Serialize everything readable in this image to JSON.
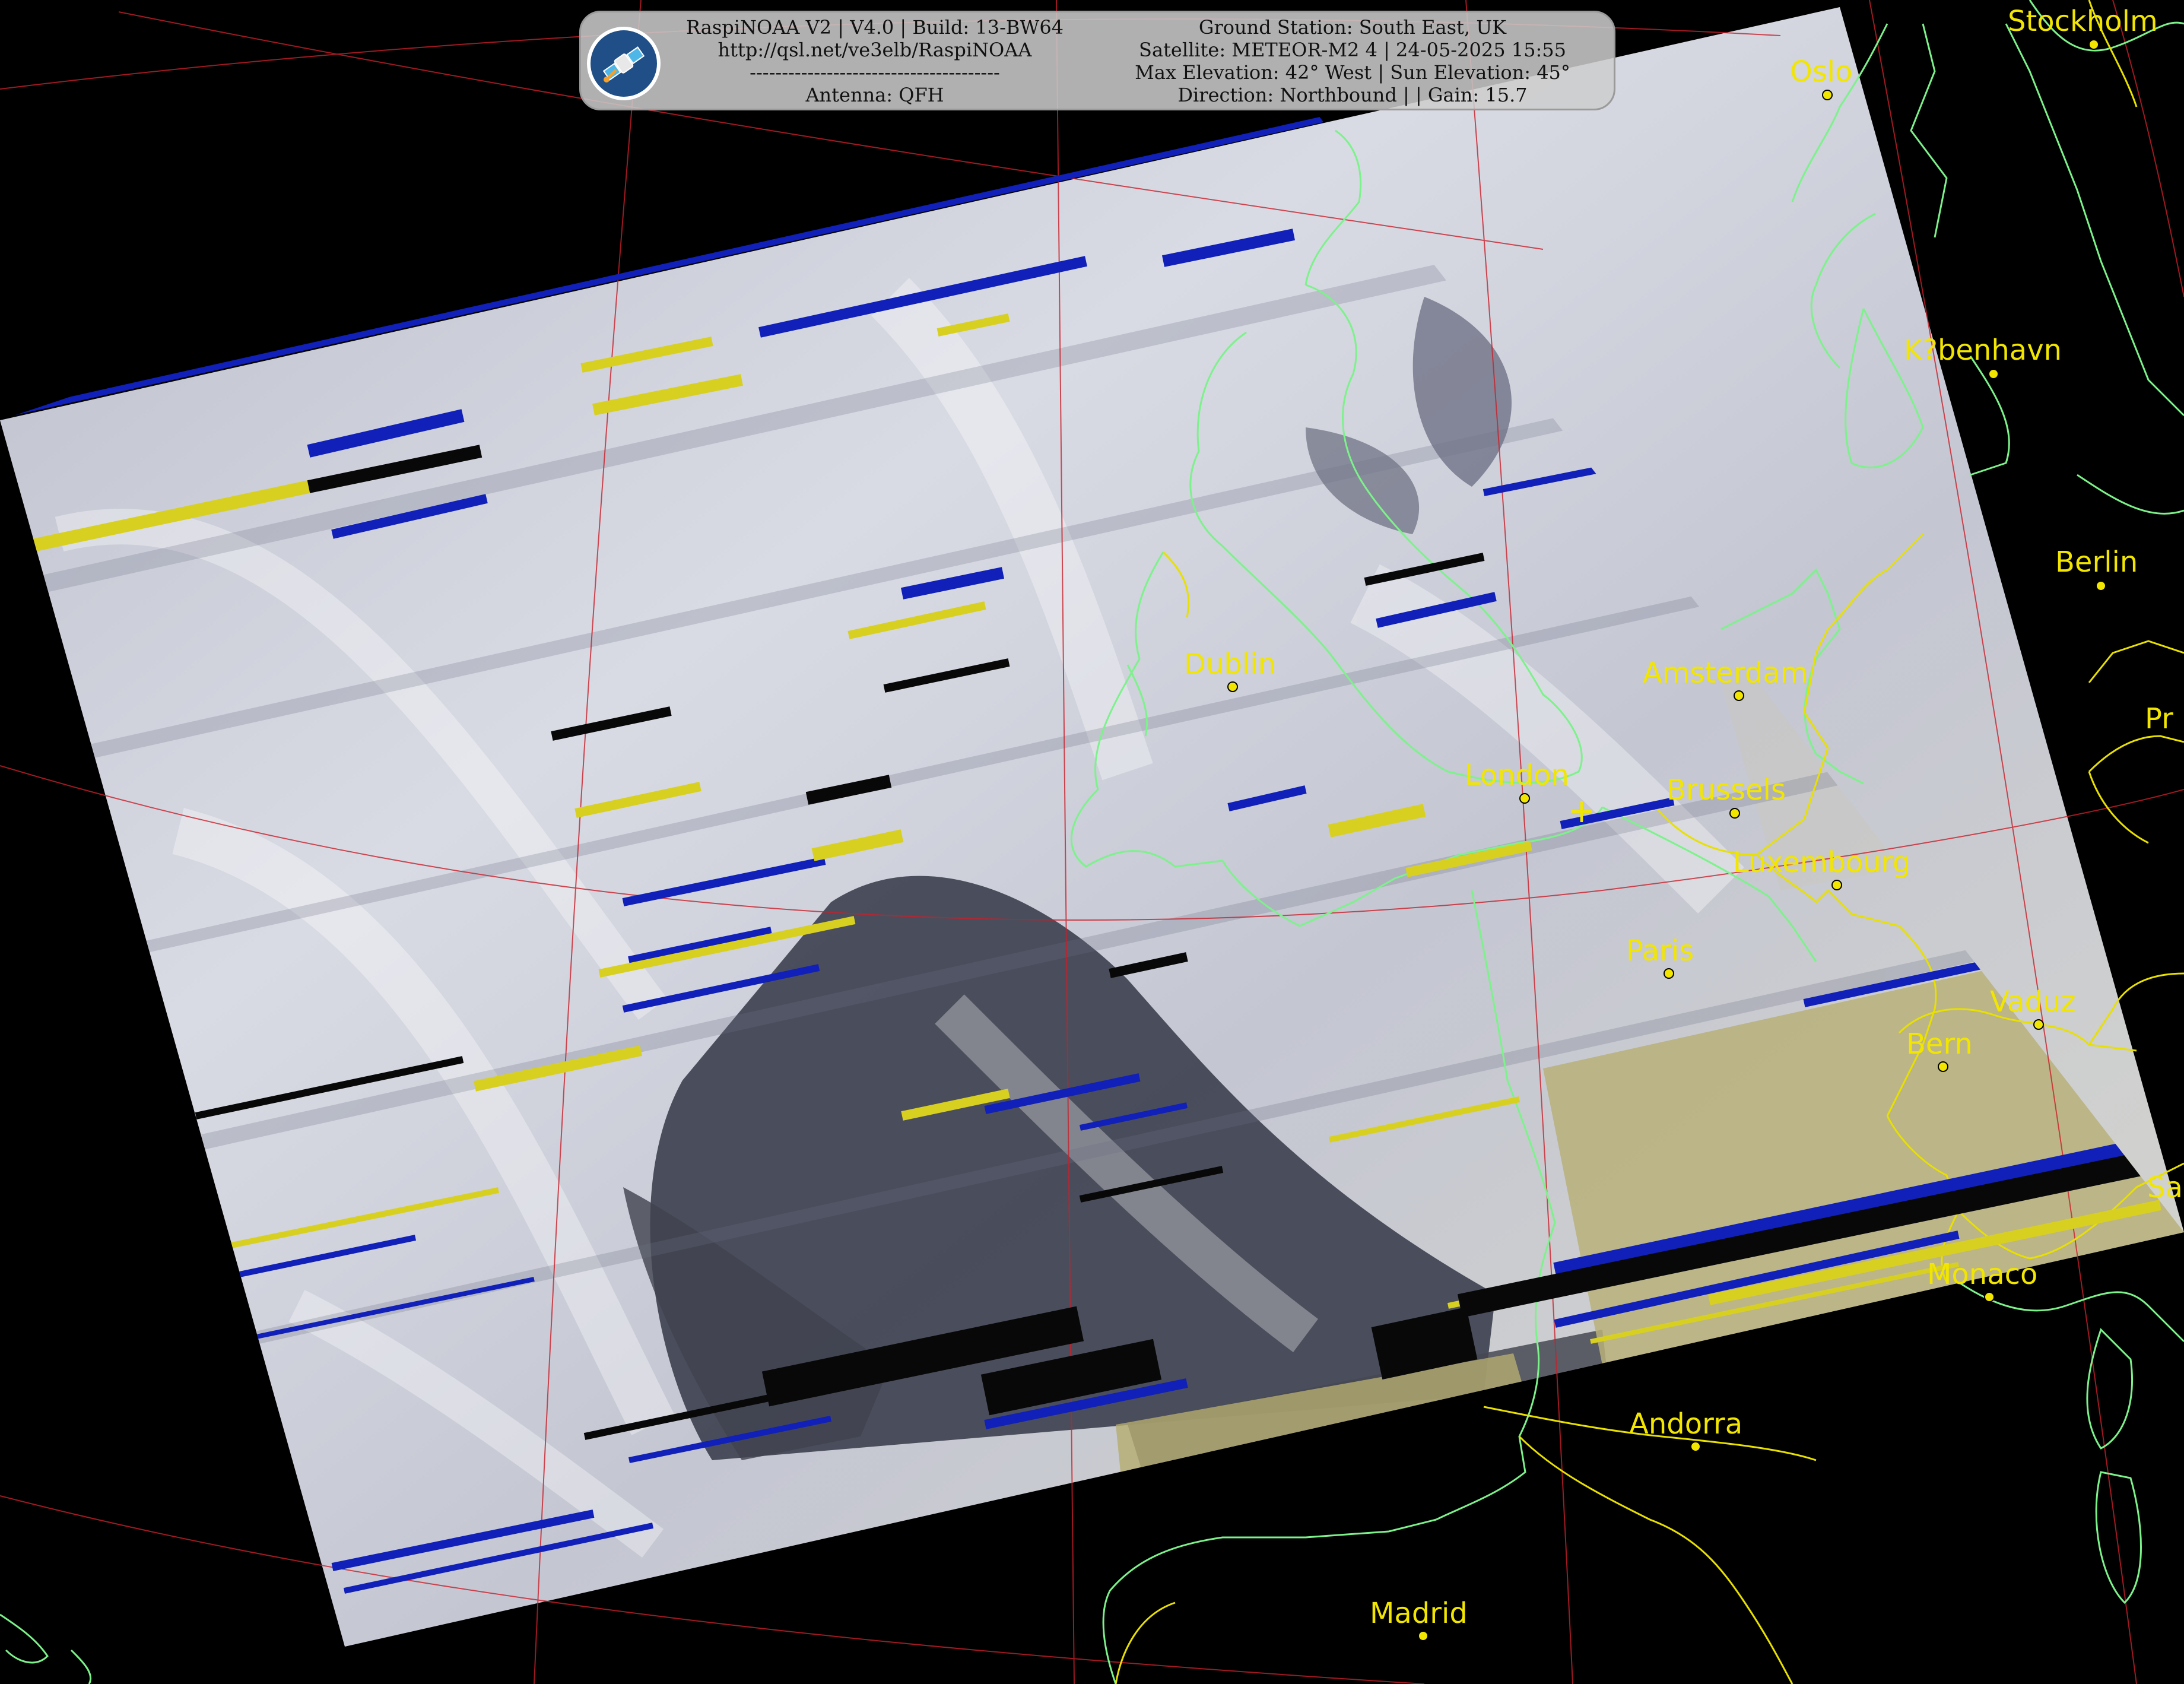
{
  "header": {
    "left_lines": [
      "RaspiNOAA V2 | V4.0 | Build: 13-BW64",
      "http://qsl.net/ve3elb/RaspiNOAA",
      "---------------------------------------",
      "Antenna: QFH"
    ],
    "right_lines": [
      "Ground Station: South East, UK",
      "Satellite: METEOR-M2 4 | 24-05-2025 15:55",
      "Max Elevation: 42° West | Sun Elevation: 45°",
      "Direction: Northbound | | Gain: 15.7"
    ],
    "logo_icon": "satellite-icon"
  },
  "cities": [
    {
      "name": "Stockholm"
    },
    {
      "name": "Oslo"
    },
    {
      "name": "K?benhavn"
    },
    {
      "name": "Berlin"
    },
    {
      "name": "Pr"
    },
    {
      "name": "Dublin"
    },
    {
      "name": "Amsterdam"
    },
    {
      "name": "London"
    },
    {
      "name": "Brussels"
    },
    {
      "name": "Luxembourg"
    },
    {
      "name": "Paris"
    },
    {
      "name": "Vaduz"
    },
    {
      "name": "Bern"
    },
    {
      "name": "Sa"
    },
    {
      "name": "Monaco"
    },
    {
      "name": "Andorra"
    },
    {
      "name": "Madrid"
    }
  ],
  "ground_station_marker": "+",
  "colors": {
    "background": "#000000",
    "city_labels": "#f2e600",
    "coastline": "#7cf28a",
    "borders": "#e8e000",
    "graticule": "#c8202a",
    "stripe_blue": "#1020b8",
    "stripe_yellow": "#d8d020"
  }
}
